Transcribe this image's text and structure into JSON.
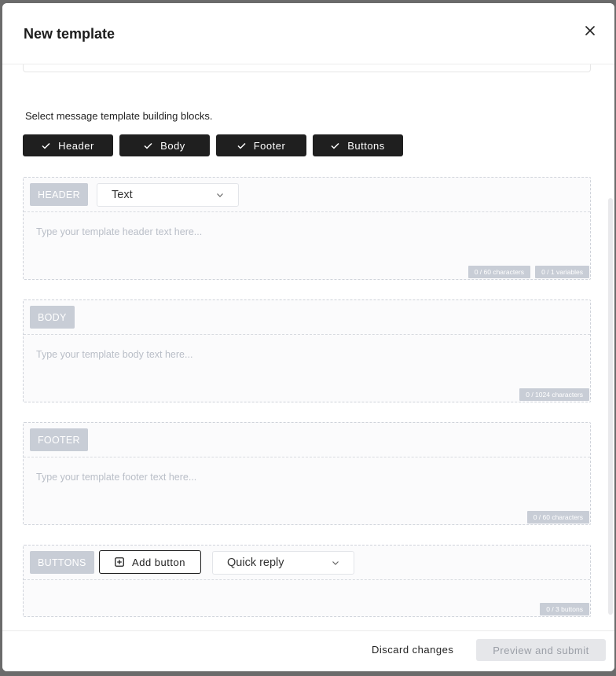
{
  "modal": {
    "title": "New template"
  },
  "builder": {
    "instruction": "Select message template building blocks.",
    "chips": [
      {
        "label": "Header",
        "icon": "check-icon"
      },
      {
        "label": "Body",
        "icon": "check-icon"
      },
      {
        "label": "Footer",
        "icon": "check-icon"
      },
      {
        "label": "Buttons",
        "icon": "check-icon"
      }
    ]
  },
  "header_block": {
    "tag": "HEADER",
    "type_select": "Text",
    "placeholder": "Type your template header text here...",
    "char_counter": "0 / 60 characters",
    "var_counter": "0 / 1 variables"
  },
  "body_block": {
    "tag": "BODY",
    "placeholder": "Type your template body text here...",
    "char_counter": "0 / 1024 characters"
  },
  "footer_block": {
    "tag": "FOOTER",
    "placeholder": "Type your template footer text here...",
    "char_counter": "0 / 60 characters"
  },
  "buttons_block": {
    "tag": "BUTTONS",
    "add_button_label": "Add button",
    "type_select": "Quick reply",
    "counter": "0 / 3 buttons"
  },
  "footer": {
    "discard_label": "Discard changes",
    "submit_label": "Preview and submit"
  },
  "colors": {
    "chip_bg": "#1f1f1f",
    "tag_bg": "#c8cdd6",
    "placeholder": "#b9bec7",
    "disabled_button_bg": "#e6e7ea"
  }
}
